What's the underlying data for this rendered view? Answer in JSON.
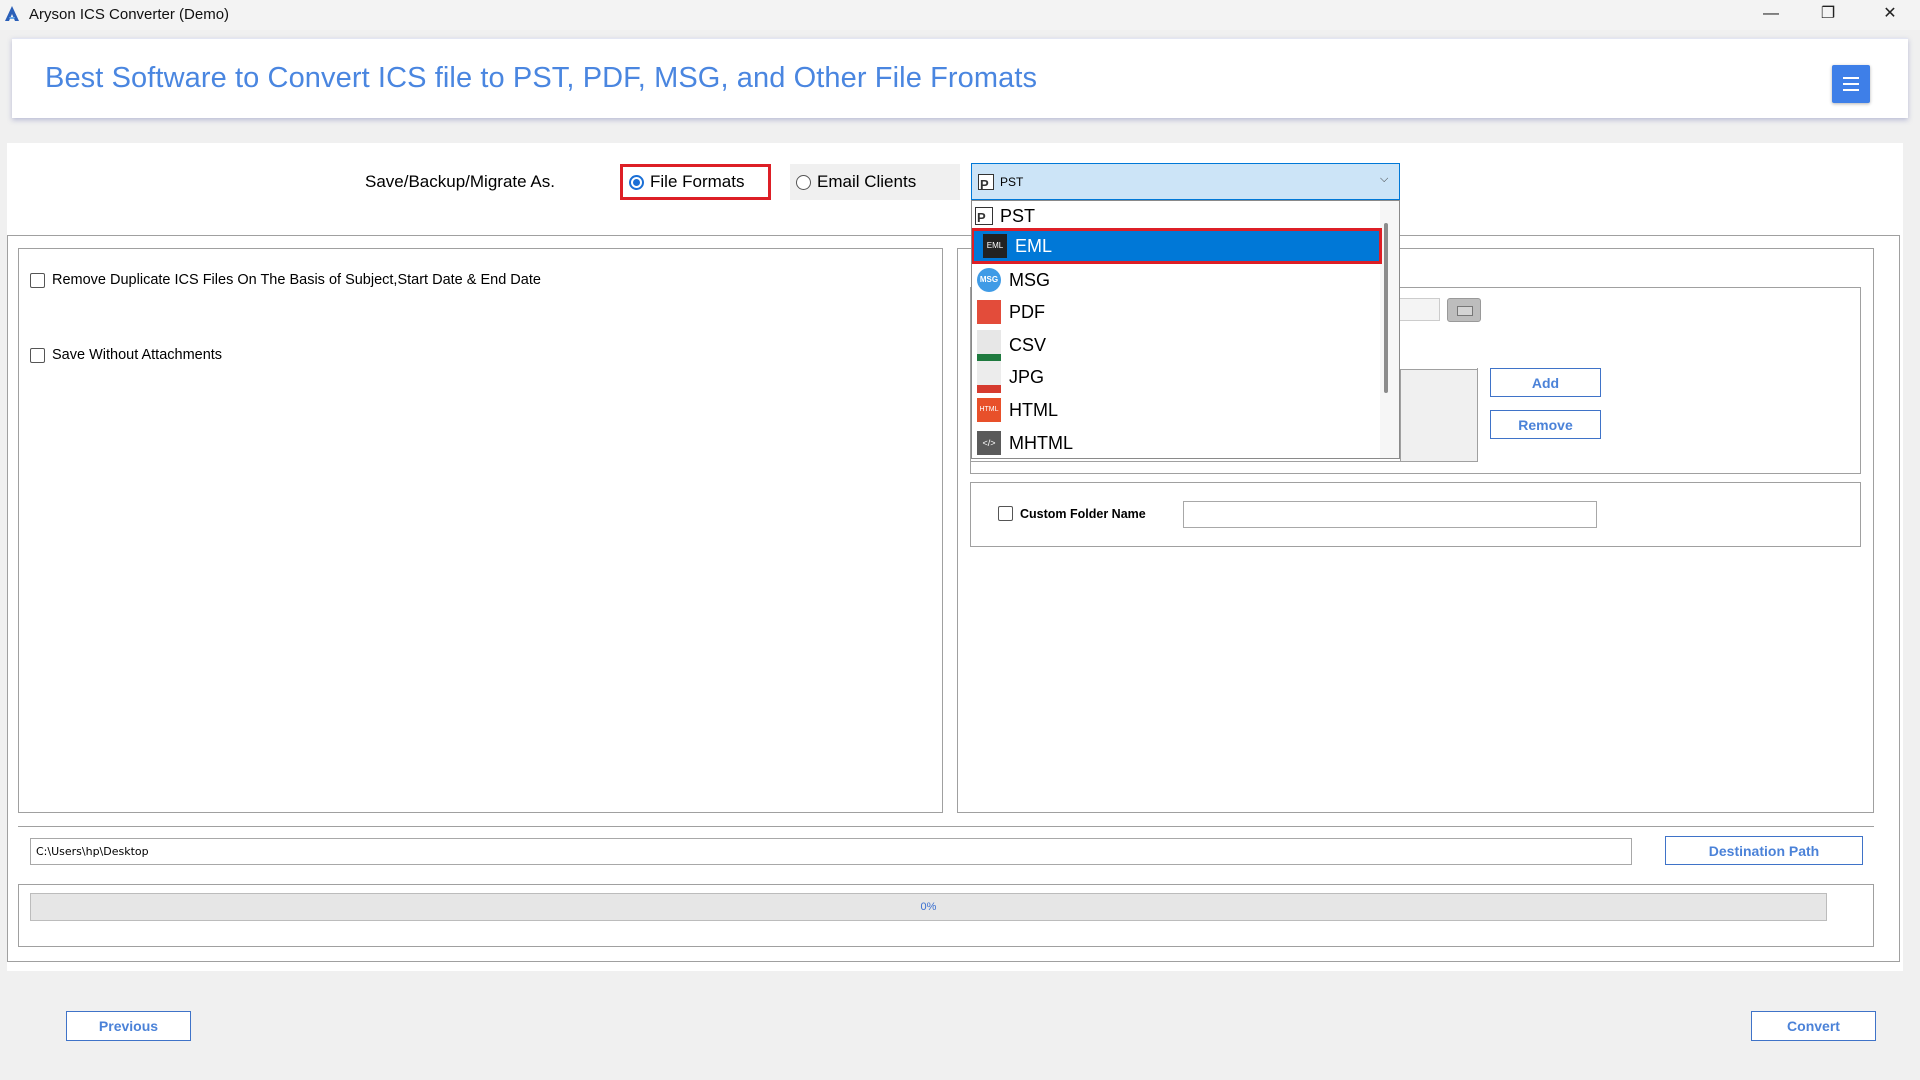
{
  "window": {
    "title": "Aryson ICS Converter (Demo)",
    "min": "—",
    "max": "❐",
    "close": "✕"
  },
  "header": {
    "title": "Best Software to Convert ICS file to PST, PDF, MSG, and Other File Fromats"
  },
  "save_as": {
    "label": "Save/Backup/Migrate As.",
    "option_file_formats": "File Formats",
    "option_email_clients": "Email Clients",
    "selected_format": "PST"
  },
  "dropdown": {
    "items": [
      {
        "label": "PST",
        "icon": "pst-icon"
      },
      {
        "label": "EML",
        "icon": "eml-icon",
        "icon_text": "EML"
      },
      {
        "label": "MSG",
        "icon": "msg-icon",
        "icon_text": "MSG"
      },
      {
        "label": "PDF",
        "icon": "pdf-icon"
      },
      {
        "label": "CSV",
        "icon": "csv-icon"
      },
      {
        "label": "JPG",
        "icon": "jpg-icon"
      },
      {
        "label": "HTML",
        "icon": "html-icon",
        "icon_text": "HTML"
      },
      {
        "label": "MHTML",
        "icon": "mhtml-icon",
        "icon_text": "</>"
      }
    ],
    "selected": "EML"
  },
  "options": {
    "remove_duplicates": "Remove Duplicate ICS Files On The Basis of Subject,Start Date & End Date",
    "save_without_attachments": "Save Without Attachments"
  },
  "filter": {
    "add": "Add",
    "remove": "Remove"
  },
  "custom_folder": {
    "label": "Custom Folder Name",
    "value": ""
  },
  "destination": {
    "path": "C:\\Users\\hp\\Desktop",
    "button": "Destination Path"
  },
  "progress": {
    "percent": 0,
    "text": "0%"
  },
  "nav": {
    "previous": "Previous",
    "convert": "Convert"
  },
  "colors": {
    "accent": "#3e7fe8",
    "highlight": "#dd1f26",
    "selection": "#0078d7",
    "header_text": "#4a86e0"
  }
}
